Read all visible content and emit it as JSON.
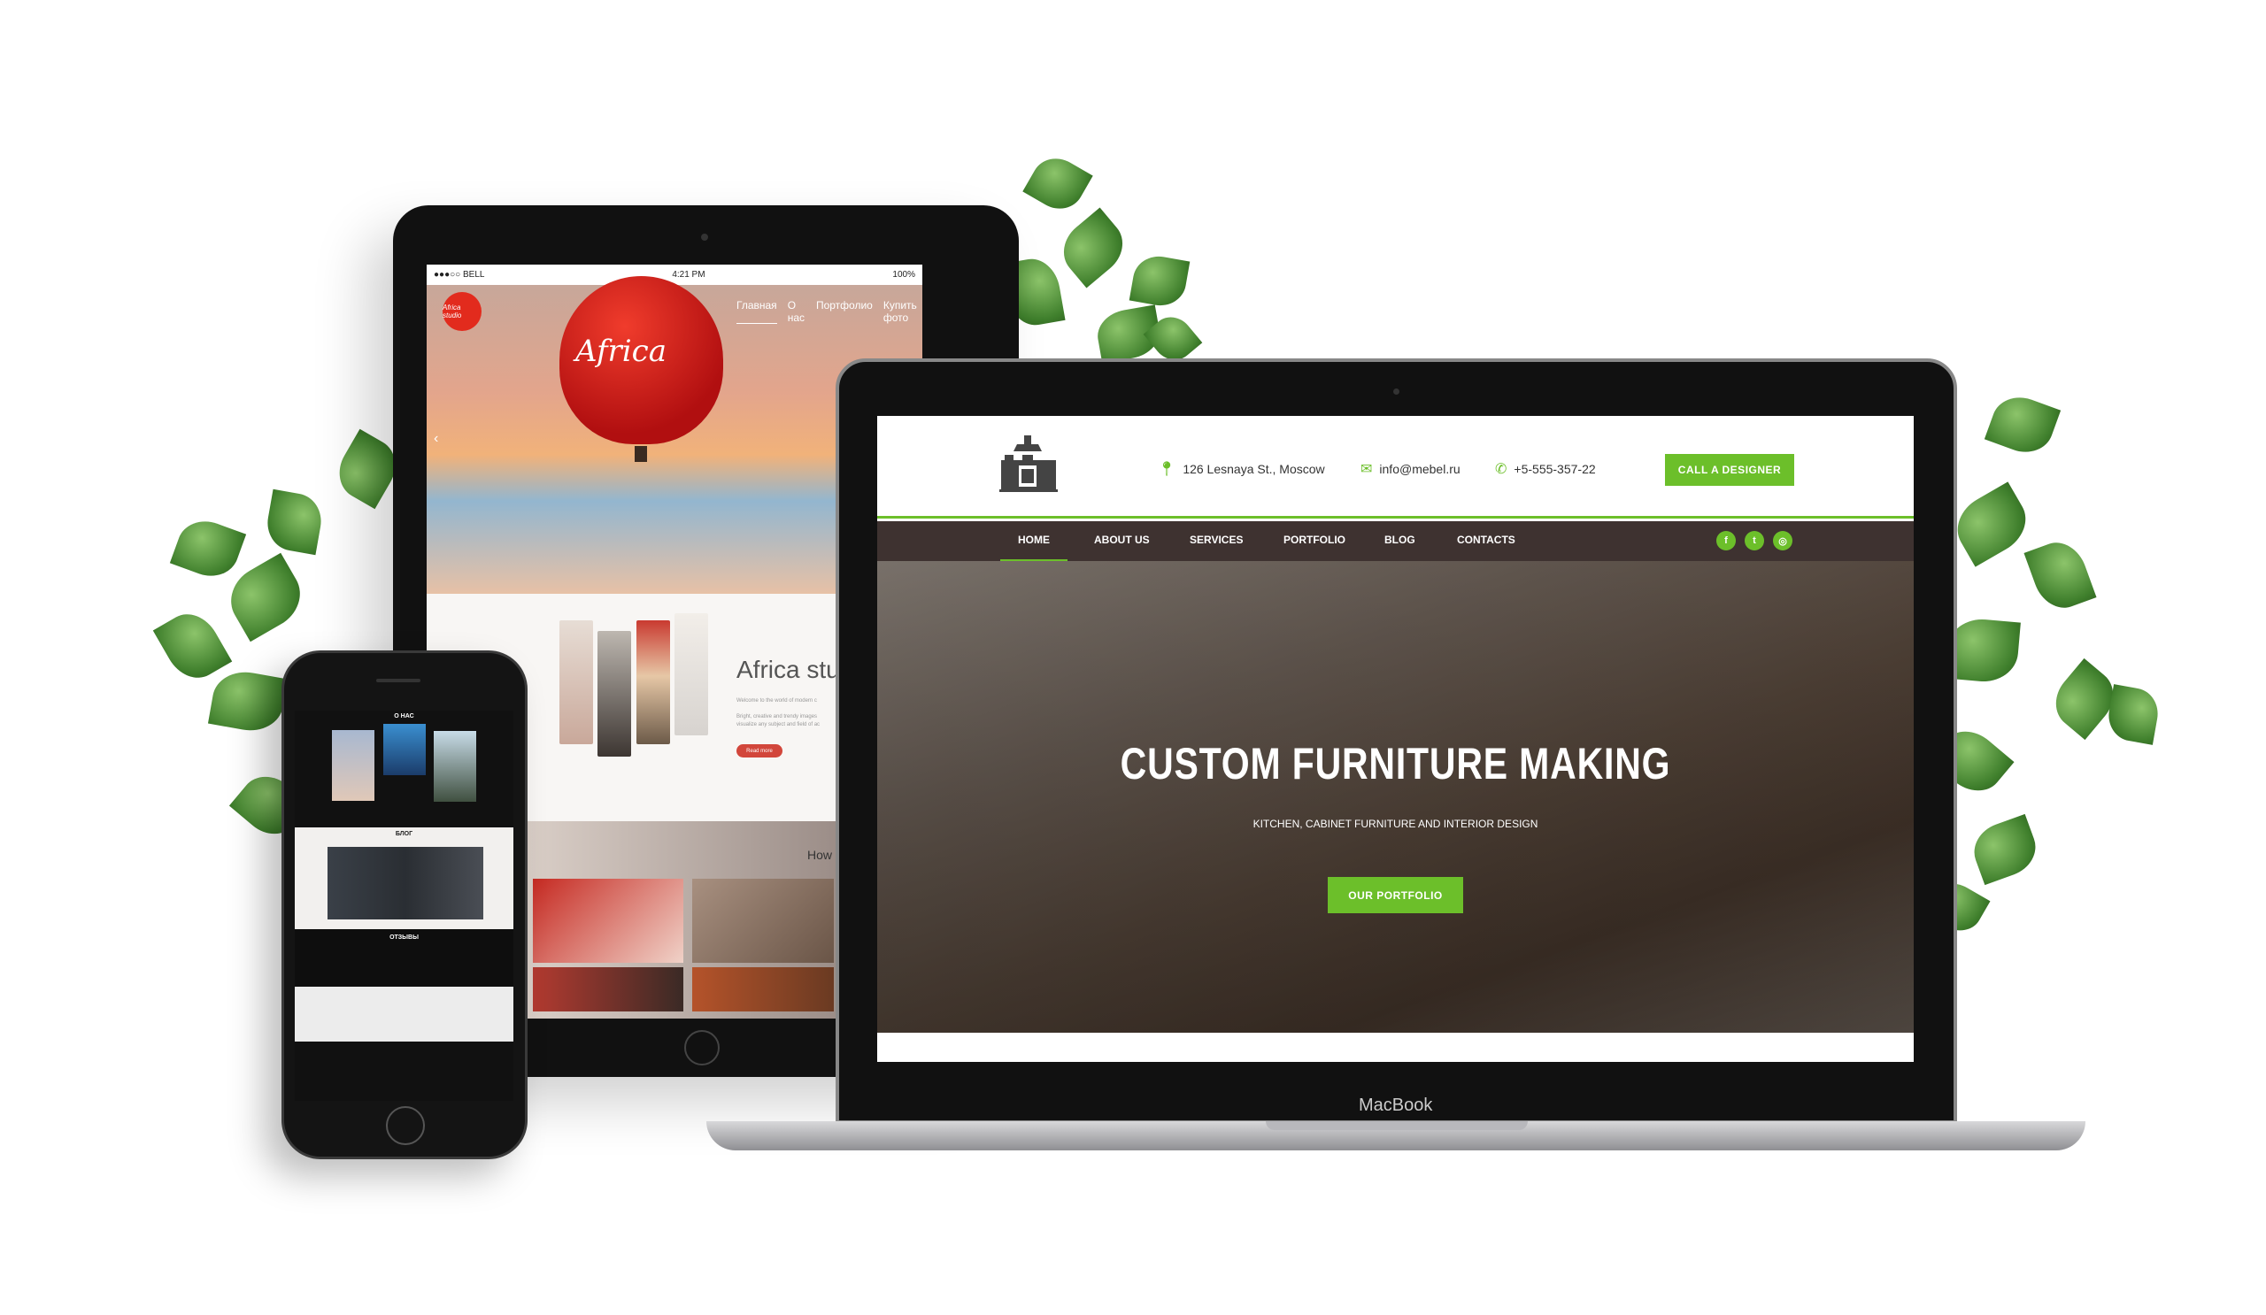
{
  "tablet": {
    "status_bar": {
      "carrier": "●●●○○ BELL",
      "time": "4:21 PM",
      "battery": "100%"
    },
    "logo_text": "Africa studio",
    "balloon_text": "Africa",
    "nav": [
      "Главная",
      "О нас",
      "Портфолио",
      "Купить фото"
    ],
    "about": {
      "heading": "Africa stu",
      "line1": "Welcome to the world of modern c",
      "line2": "Bright, creative and trendy images",
      "line3": "visualize any subject and field of ac",
      "read_more": "Read more"
    },
    "gallery_heading": "How"
  },
  "laptop": {
    "brand": "MacBook",
    "header": {
      "address": "126 Lesnaya St., Moscow",
      "email": "info@mebel.ru",
      "phone": "+5-555-357-22",
      "cta": "CALL A DESIGNER"
    },
    "nav": [
      {
        "label": "HOME",
        "active": true
      },
      {
        "label": "ABOUT US"
      },
      {
        "label": "SERVICES"
      },
      {
        "label": "PORTFOLIO"
      },
      {
        "label": "BLOG"
      },
      {
        "label": "CONTACTS"
      }
    ],
    "social": [
      "f",
      "t",
      "◎"
    ],
    "hero": {
      "title": "CUSTOM FURNITURE MAKING",
      "subtitle": "KITCHEN, CABINET FURNITURE AND INTERIOR DESIGN",
      "button": "OUR PORTFOLIO"
    },
    "accent": "#6cbf2a",
    "nav_bg": "#3e3230"
  },
  "phone": {
    "sections": [
      "О НАС",
      "БЛОГ",
      "ОТЗЫВЫ"
    ]
  }
}
